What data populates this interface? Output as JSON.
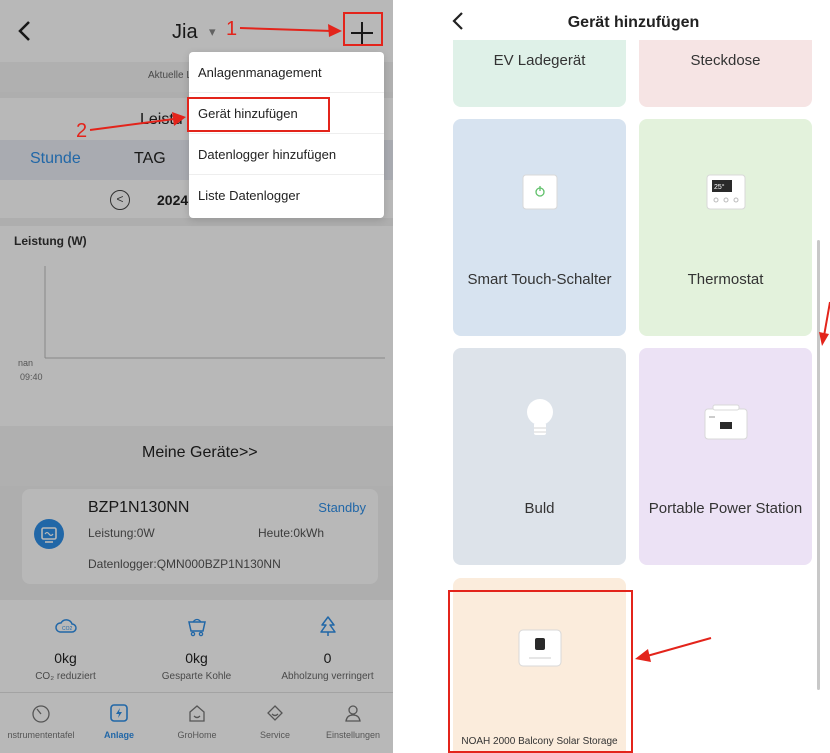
{
  "left": {
    "header": {
      "back_icon": "chevron-left-icon",
      "title": "Jia",
      "caret_icon": "caret-down-icon",
      "add_icon": "plus-icon"
    },
    "subheader": {
      "text": "Aktuelle L"
    },
    "power_card": {
      "title": "Leistu",
      "tabs": [
        "Stunde",
        "TAG"
      ],
      "active_tab": "Stunde",
      "date_text": "2024",
      "accent": "#2f8fe8"
    },
    "chart": {
      "label": "Leistung (W)",
      "y_tick": "nan",
      "x_tick": "09:40"
    },
    "my_devices": "Meine Geräte>>",
    "device": {
      "name": "BZP1N130NN",
      "status": "Standby",
      "power": "Leistung:0W",
      "today": "Heute:0kWh",
      "logger": "Datenlogger:QMN000BZP1N130NN"
    },
    "stats": [
      {
        "icon": "co2-cloud-icon",
        "value": "0kg",
        "label": "CO₂ reduziert"
      },
      {
        "icon": "coal-cart-icon",
        "value": "0kg",
        "label": "Gesparte Kohle"
      },
      {
        "icon": "tree-icon",
        "value": "0",
        "label": "Abholzung verringert"
      }
    ],
    "nav": [
      {
        "icon": "dashboard-icon",
        "label": "nstrumententafel"
      },
      {
        "icon": "plant-icon",
        "label": "Anlage",
        "active": true
      },
      {
        "icon": "home-icon",
        "label": "GroHome"
      },
      {
        "icon": "service-icon",
        "label": "Service"
      },
      {
        "icon": "person-icon",
        "label": "Einstellungen"
      }
    ],
    "menu": [
      "Anlagenmanagement",
      "Gerät hinzufügen",
      "Datenlogger hinzufügen",
      "Liste Datenlogger"
    ],
    "annotations": {
      "step1": "1",
      "step2": "2",
      "color": "#e3241b"
    }
  },
  "right": {
    "header": {
      "back_icon": "chevron-left-icon",
      "title": "Gerät hinzufügen"
    },
    "tiles": [
      {
        "label": "EV Ladegerät",
        "icon": "ev-charger-icon",
        "bg": "#dff1e8"
      },
      {
        "label": "Steckdose",
        "icon": "socket-icon",
        "bg": "#f6e4e4"
      },
      {
        "label": "Smart Touch-Schalter",
        "icon": "touch-switch-icon",
        "bg": "#d7e3f0"
      },
      {
        "label": "Thermostat",
        "icon": "thermostat-icon",
        "bg": "#e3f2dc"
      },
      {
        "label": "Buld",
        "icon": "bulb-icon",
        "bg": "#dde3ea"
      },
      {
        "label": "Portable Power Station",
        "icon": "power-station-icon",
        "bg": "#ece2f5"
      },
      {
        "label": "NOAH 2000 Balcony Solar Storage",
        "icon": "noah-storage-icon",
        "bg": "#fbecdc"
      }
    ],
    "thermostat_display": "25°"
  }
}
